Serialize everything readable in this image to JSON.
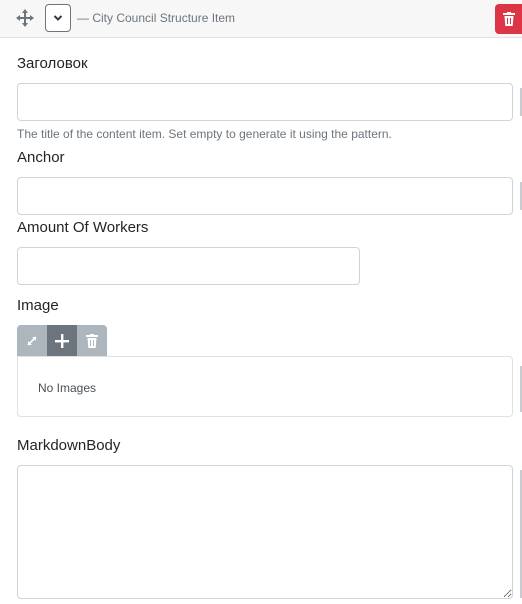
{
  "header": {
    "title": "— City Council Structure Item",
    "move_icon": "move-arrows-icon",
    "collapse_icon": "chevron-down-icon",
    "delete_icon": "trash-icon",
    "delete_color": "#dc3545"
  },
  "fields": {
    "title": {
      "label": "Заголовок",
      "value": "",
      "hint": "The title of the content item. Set empty to generate it using the pattern."
    },
    "anchor": {
      "label": "Anchor",
      "value": ""
    },
    "workers": {
      "label": "Amount Of Workers",
      "value": ""
    },
    "image": {
      "label": "Image",
      "toolbar": [
        "expand-icon",
        "plus-icon",
        "trash-icon"
      ],
      "empty_text": "No Images"
    },
    "markdown": {
      "label": "MarkdownBody",
      "value": ""
    }
  }
}
